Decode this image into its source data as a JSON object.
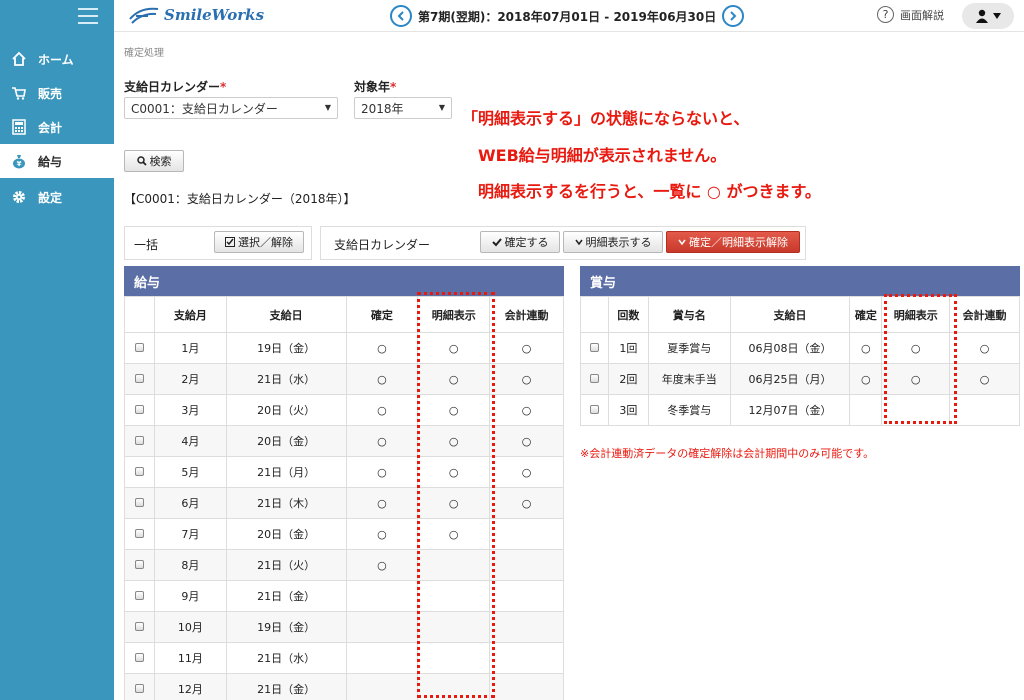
{
  "header": {
    "logo": "SmileWorks",
    "period": "第7期(翌期)：2018年07月01日 - 2019年06月30日",
    "help_label": "画面解説"
  },
  "sidebar": {
    "items": [
      {
        "label": "ホーム",
        "icon": "home-icon"
      },
      {
        "label": "販売",
        "icon": "cart-icon"
      },
      {
        "label": "会計",
        "icon": "calculator-icon"
      },
      {
        "label": "給与",
        "icon": "money-bag-icon",
        "active": true
      },
      {
        "label": "設定",
        "icon": "gear-icon"
      }
    ]
  },
  "breadcrumb": "確定処理",
  "form": {
    "calendar_label": "支給日カレンダー",
    "calendar_value": "C0001：支給日カレンダー",
    "year_label": "対象年",
    "year_value": "2018年",
    "required_mark": "*",
    "search_label": "検索"
  },
  "calendar_title": "【C0001：支給日カレンダー（2018年）】",
  "bulk": {
    "label": "一括",
    "select_button": "選択／解除"
  },
  "actions": {
    "label": "支給日カレンダー",
    "confirm": "確定する",
    "detail": "明細表示する",
    "release": "確定／明細表示解除"
  },
  "annotation": {
    "line1": "「明細表示する」の状態にならないと、",
    "line2": "WEB給与明細が表示されません。",
    "line3": "明細表示するを行うと、一覧に ○ がつきます。"
  },
  "salary": {
    "title": "給与",
    "headers": [
      "",
      "支給月",
      "支給日",
      "確定",
      "明細表示",
      "会計連動"
    ],
    "rows": [
      {
        "month": "1月",
        "day": "19日（金）",
        "confirmed": "○",
        "detail": "○",
        "linked": "○"
      },
      {
        "month": "2月",
        "day": "21日（水）",
        "confirmed": "○",
        "detail": "○",
        "linked": "○"
      },
      {
        "month": "3月",
        "day": "20日（火）",
        "confirmed": "○",
        "detail": "○",
        "linked": "○"
      },
      {
        "month": "4月",
        "day": "20日（金）",
        "confirmed": "○",
        "detail": "○",
        "linked": "○"
      },
      {
        "month": "5月",
        "day": "21日（月）",
        "confirmed": "○",
        "detail": "○",
        "linked": "○"
      },
      {
        "month": "6月",
        "day": "21日（木）",
        "confirmed": "○",
        "detail": "○",
        "linked": "○"
      },
      {
        "month": "7月",
        "day": "20日（金）",
        "confirmed": "○",
        "detail": "○",
        "linked": ""
      },
      {
        "month": "8月",
        "day": "21日（火）",
        "confirmed": "○",
        "detail": "",
        "linked": ""
      },
      {
        "month": "9月",
        "day": "21日（金）",
        "confirmed": "",
        "detail": "",
        "linked": ""
      },
      {
        "month": "10月",
        "day": "19日（金）",
        "confirmed": "",
        "detail": "",
        "linked": ""
      },
      {
        "month": "11月",
        "day": "21日（水）",
        "confirmed": "",
        "detail": "",
        "linked": ""
      },
      {
        "month": "12月",
        "day": "21日（金）",
        "confirmed": "",
        "detail": "",
        "linked": ""
      }
    ]
  },
  "bonus": {
    "title": "賞与",
    "headers": [
      "",
      "回数",
      "賞与名",
      "支給日",
      "確定",
      "明細表示",
      "会計連動"
    ],
    "rows": [
      {
        "count": "1回",
        "name": "夏季賞与",
        "day": "06月08日（金）",
        "confirmed": "○",
        "detail": "○",
        "linked": "○"
      },
      {
        "count": "2回",
        "name": "年度末手当",
        "day": "06月25日（月）",
        "confirmed": "○",
        "detail": "○",
        "linked": "○"
      },
      {
        "count": "3回",
        "name": "冬季賞与",
        "day": "12月07日（金）",
        "confirmed": "",
        "detail": "",
        "linked": ""
      }
    ]
  },
  "note": "※会計連動済データの確定解除は会計期間中のみ可能です。",
  "colors": {
    "sidebar": "#3a96bd",
    "section_header": "#5b6fa6",
    "annotation": "#e8190f",
    "release_button": "#d04535"
  }
}
